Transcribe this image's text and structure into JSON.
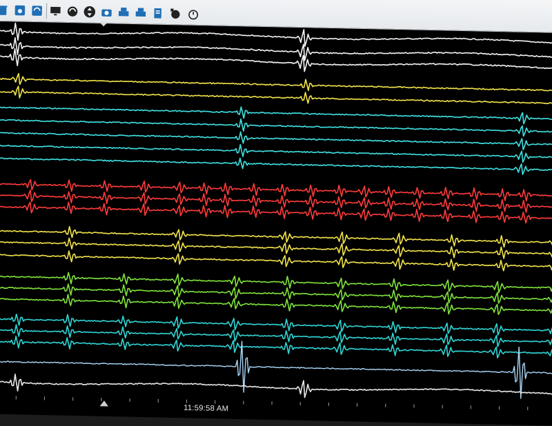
{
  "toolbar": {
    "buttons": [
      {
        "icon": "trash-icon"
      },
      {
        "icon": "disk-icon"
      },
      {
        "icon": "refresh-arrows-icon"
      },
      {
        "icon": "monitor-icon"
      },
      {
        "icon": "cycle-icon"
      },
      {
        "icon": "up-down-icon"
      },
      {
        "icon": "camera-icon"
      },
      {
        "icon": "printer-icon"
      },
      {
        "icon": "printer-2-icon"
      },
      {
        "icon": "document-stack-icon"
      },
      {
        "icon": "timer-clock-icon"
      },
      {
        "icon": "stopwatch-icon"
      }
    ]
  },
  "channels": [
    {
      "group": "surface-white",
      "color": "#f2f2f2"
    },
    {
      "group": "surface-white",
      "color": "#f2f2f2"
    },
    {
      "group": "surface-white",
      "color": "#f2f2f2"
    },
    {
      "group": "yellow-1",
      "color": "#f0e24a"
    },
    {
      "group": "yellow-1",
      "color": "#f0e24a"
    },
    {
      "group": "cyan-1",
      "color": "#3fe0e0"
    },
    {
      "group": "cyan-1",
      "color": "#3fe0e0"
    },
    {
      "group": "cyan-1",
      "color": "#3fe0e0"
    },
    {
      "group": "cyan-1",
      "color": "#3fe0e0"
    },
    {
      "group": "cyan-1",
      "color": "#3fe0e0"
    },
    {
      "group": "red",
      "color": "#ff3b3b"
    },
    {
      "group": "red",
      "color": "#ff3b3b"
    },
    {
      "group": "red",
      "color": "#ff3b3b"
    },
    {
      "group": "yellow-2",
      "color": "#f0e24a"
    },
    {
      "group": "yellow-2",
      "color": "#f0e24a"
    },
    {
      "group": "yellow-2",
      "color": "#f0e24a"
    },
    {
      "group": "green",
      "color": "#7fe23a"
    },
    {
      "group": "green",
      "color": "#7fe23a"
    },
    {
      "group": "green",
      "color": "#7fe23a"
    },
    {
      "group": "cyan-2",
      "color": "#2fd4d4"
    },
    {
      "group": "cyan-2",
      "color": "#2fd4d4"
    },
    {
      "group": "cyan-2",
      "color": "#2fd4d4"
    },
    {
      "group": "ablation-blue",
      "color": "#a9d4f5"
    },
    {
      "group": "surface-white-bottom",
      "color": "#e6e6e6"
    }
  ],
  "status": {
    "timestamp": "11:59:58 AM"
  }
}
